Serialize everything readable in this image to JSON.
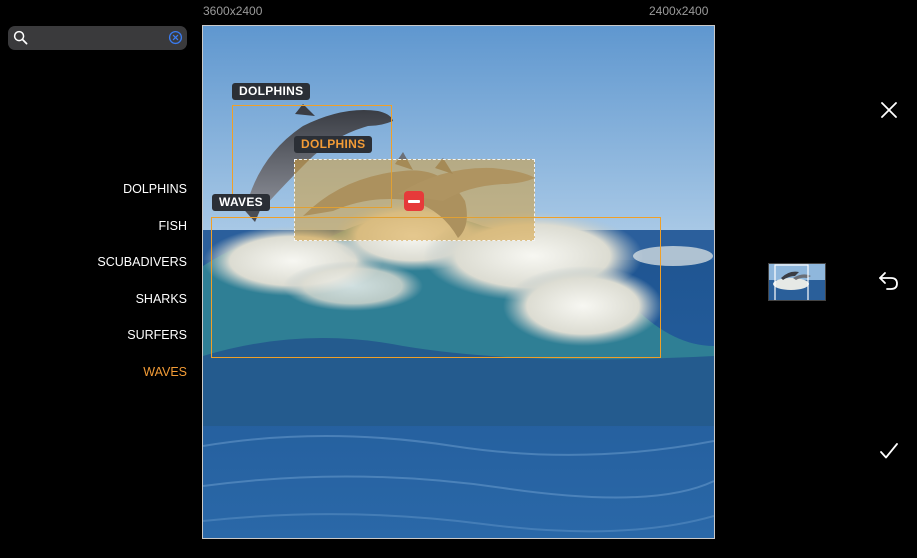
{
  "header": {
    "left_size": "3600x2400",
    "right_size": "2400x2400"
  },
  "search": {
    "placeholder": "",
    "value": "",
    "search_icon": "search-icon",
    "clear_icon": "clear-icon"
  },
  "categories": [
    {
      "label": "DOLPHINS",
      "active": false
    },
    {
      "label": "FISH",
      "active": false
    },
    {
      "label": "SCUBADIVERS",
      "active": false
    },
    {
      "label": "SHARKS",
      "active": false
    },
    {
      "label": "SURFERS",
      "active": false
    },
    {
      "label": "WAVES",
      "active": true
    }
  ],
  "annotations": [
    {
      "label": "DOLPHINS",
      "style": "normal"
    },
    {
      "label": "DOLPHINS",
      "style": "selected"
    },
    {
      "label": "WAVES",
      "style": "normal"
    }
  ],
  "controls": {
    "close_icon": "close-icon",
    "undo_icon": "undo-icon",
    "confirm_icon": "checkmark-icon"
  },
  "colors": {
    "accent": "#f29b36",
    "box_stroke": "#f0a028",
    "remove": "#e63a3a",
    "tag_bg": "#2b2f36"
  }
}
